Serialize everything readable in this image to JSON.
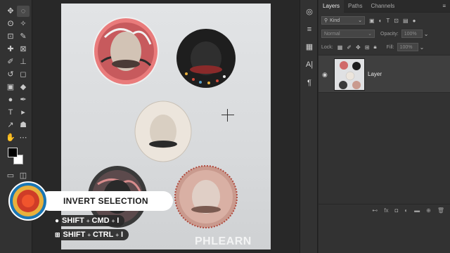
{
  "toolbar": {
    "tools": [
      "move-icon",
      "marquee-icon",
      "lasso-icon",
      "magic-wand-icon",
      "crop-icon",
      "eyedropper-icon",
      "healing-icon",
      "frame-icon",
      "brush-icon",
      "stamp-icon",
      "history-brush-icon",
      "eraser-icon",
      "gradient-icon",
      "blur-icon",
      "dodge-icon",
      "pen-icon",
      "type-icon",
      "path-select-icon",
      "direct-select-icon",
      "shape-icon",
      "hand-icon",
      "more-icon",
      "zoom-icon"
    ],
    "glyphs": [
      "✥",
      "◌",
      "ʘ",
      "✧",
      "⊡",
      "✎",
      "✚",
      "⊠",
      "✐",
      "⊥",
      "↺",
      "◻",
      "▣",
      "◆",
      "●",
      "✒",
      "T",
      "▸",
      "↗",
      "☗",
      "✋",
      "⋯",
      "⚲"
    ]
  },
  "iconstrip": {
    "glyphs": [
      "◎",
      "≡",
      "▦",
      "A|",
      "¶"
    ]
  },
  "panel": {
    "tabs": [
      "Layers",
      "Paths",
      "Channels"
    ],
    "kind": "Kind",
    "blend": "Normal",
    "opacity_label": "Opacity:",
    "opacity_value": "100%",
    "lock_label": "Lock:",
    "fill_label": "Fill:",
    "fill_value": "100%",
    "layer_name": "Layer"
  },
  "canvas": {
    "watermark": "PHLEARN"
  },
  "overlay": {
    "title": "INVERT SELECTION",
    "shortcuts": [
      {
        "os": "",
        "keys": [
          "SHIFT",
          "CMD",
          "I"
        ]
      },
      {
        "os": "⊞",
        "keys": [
          "SHIFT",
          "CTRL",
          "I"
        ]
      }
    ]
  },
  "colors": {
    "accent_blue": "#1a76b4",
    "accent_orange": "#f0552d",
    "accent_yellow": "#e8b03c",
    "accent_red": "#cf3c27"
  }
}
